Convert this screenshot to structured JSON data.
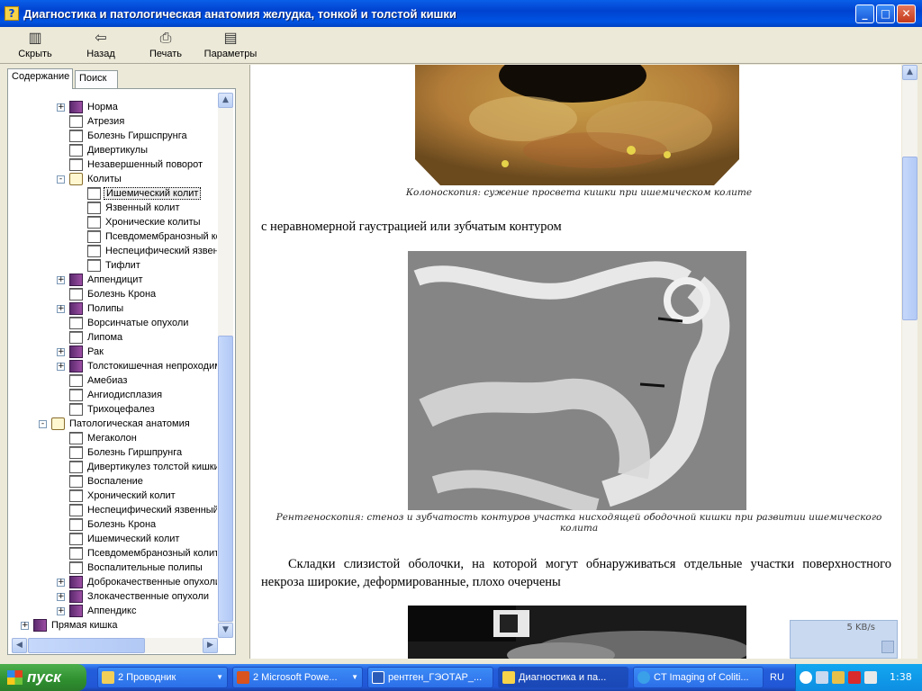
{
  "window": {
    "title": "Диагностика и патологическая анатомия желудка, тонкой и толстой кишки"
  },
  "toolbar": {
    "hide": "Скрыть",
    "back": "Назад",
    "print": "Печать",
    "options": "Параметры"
  },
  "tabs": {
    "contents": "Содержание",
    "search": "Поиск"
  },
  "tree": [
    "Норма",
    "Атрезия",
    "Болезнь Гиршспрунга",
    "Дивертикулы",
    "Незавершенный поворот",
    "Колиты",
    "Ишемический колит",
    "Язвенный колит",
    "Хронические колиты",
    "Псевдомембранозный колит",
    "Неспецифический язвенный колит",
    "Тифлит",
    "Аппендицит",
    "Болезнь Крона",
    "Полипы",
    "Ворсинчатые опухоли",
    "Липома",
    "Рак",
    "Толстокишечная непроходимость",
    "Амебиаз",
    "Ангиодисплазия",
    "Трихоцефалез",
    "Патологическая анатомия",
    "Мегаколон",
    "Болезнь Гиршпрунга",
    "Дивертикулез толстой кишки",
    "Воспаление",
    "Хронический колит",
    "Неспецифический язвенный колит",
    "Болезнь Крона",
    "Ишемический колит",
    "Псевдомембранозный колит",
    "Воспалительные полипы",
    "Доброкачественные опухоли",
    "Злокачественные опухоли",
    "Аппендикс",
    "Прямая кишка"
  ],
  "content": {
    "caption1": "Колоноскопия: сужение просвета кишки при ишемическом колите",
    "text1": "с неравномерной гаустрацией или зубчатым контуром",
    "caption2": "Рентгеноскопия: стеноз и зубчатость контуров участка нисходящей ободочной кишки при развитии ишемического колита",
    "text2": "Складки слизистой оболочки, на которой могут обнаруживаться отдельные участки поверхностного некроза широкие, деформированные, плохо очерчены"
  },
  "network": {
    "speed": "5 KB/s"
  },
  "taskbar": {
    "start": "пуск",
    "tasks": [
      "2 Проводник",
      "2 Microsoft Powe...",
      "рентген_ГЭОТАР_...",
      "Диагностика и па...",
      "CT Imaging of Coliti..."
    ],
    "lang": "RU",
    "clock": "1:38"
  },
  "colors": {
    "titlebar": "#0054e3",
    "taskbar": "#245edb",
    "start": "#2f8f2f",
    "tray": "#0e8ee2",
    "book": "#7b3a89"
  }
}
